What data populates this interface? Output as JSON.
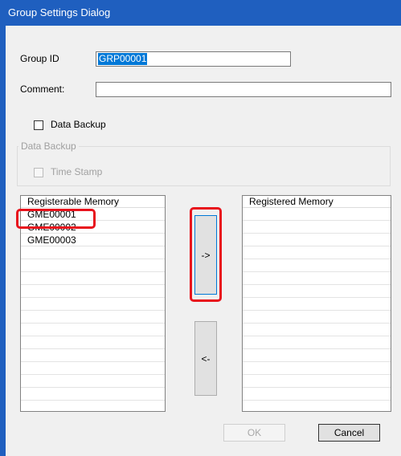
{
  "dialog": {
    "title": "Group Settings Dialog",
    "group_id_label": "Group ID",
    "group_id_value": "GRP00001",
    "comment_label": "Comment:",
    "comment_value": "",
    "data_backup_checkbox_label": "Data Backup",
    "data_backup_checked": false,
    "data_backup_group_title": "Data Backup",
    "time_stamp_label": "Time Stamp",
    "time_stamp_checked": false,
    "time_stamp_enabled": false
  },
  "registerable_list": {
    "header": "Registerable Memory",
    "items": [
      "GME00001",
      "GME00002",
      "GME00003"
    ],
    "highlighted_item": "GME00001"
  },
  "registered_list": {
    "header": "Registered Memory",
    "items": []
  },
  "buttons": {
    "add": "->",
    "remove": "<-",
    "ok": "OK",
    "ok_enabled": false,
    "cancel": "Cancel"
  },
  "colors": {
    "titlebar": "#1f5fbf",
    "selection": "#0078d7",
    "annotation": "#e8121c"
  }
}
